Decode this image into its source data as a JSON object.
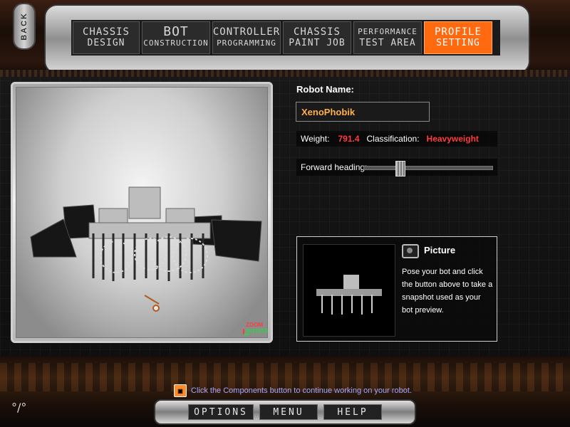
{
  "colors": {
    "accent_orange": "#ff6a10",
    "robot_name": "#ffb04a",
    "value_red": "#ff3b3b",
    "hint_text": "#a9a6ff",
    "rotate_green": "#34d04a"
  },
  "back": {
    "label": "BACK"
  },
  "tabs": [
    {
      "line1": "CHASSIS",
      "line2": "DESIGN",
      "active": false
    },
    {
      "line1": "BOT",
      "line2": "CONSTRUCTION",
      "active": false
    },
    {
      "line1": "CONTROLLER",
      "line2": "PROGRAMMING",
      "active": false
    },
    {
      "line1": "CHASSIS",
      "line2": "PAINT JOB",
      "active": false
    },
    {
      "line1": "PERFORMANCE",
      "line2": "TEST AREA",
      "active": false
    },
    {
      "line1": "PROFILE",
      "line2": "SETTING",
      "active": true
    }
  ],
  "viewport": {
    "zoom_label": "ZOOM",
    "rotate_label": "ROTATE",
    "robot_icon": "robot-render-icon"
  },
  "profile": {
    "robot_name_label": "Robot Name:",
    "robot_name_value": "XenoPhobik",
    "weight_label": "Weight:",
    "weight_value": "791.4",
    "classification_label": "Classification:",
    "classification_value": "Heavyweight",
    "forward_heading_label": "Forward heading:",
    "forward_heading_value": 0.3
  },
  "picture": {
    "title": "Picture",
    "description": "Pose your bot and click the button above to take a snapshot used as your bot preview."
  },
  "hint": {
    "text": "Click the Components button to continue working on your robot."
  },
  "bottom_nav": {
    "options_label": "OPTIONS",
    "menu_label": "MENU",
    "help_label": "HELP"
  },
  "corner_mark": "°/°"
}
